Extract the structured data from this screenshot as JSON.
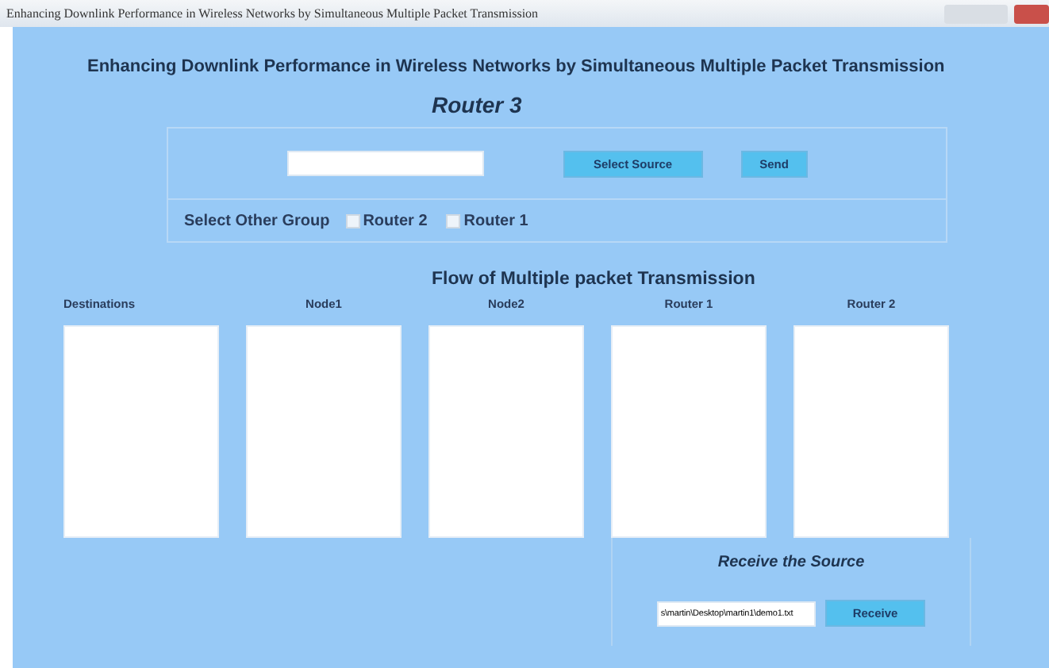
{
  "window": {
    "title": "Enhancing Downlink Performance in Wireless Networks by Simultaneous Multiple Packet Transmission"
  },
  "heading": "Enhancing Downlink Performance in Wireless Networks by Simultaneous Multiple Packet Transmission",
  "router_title": "Router 3",
  "source": {
    "buttons": [
      "Select Source",
      "Send"
    ]
  },
  "group": {
    "label": "Select Other Group",
    "options": [
      {
        "label": "Router 2",
        "checked": false
      },
      {
        "label": "Router 1",
        "checked": false
      }
    ]
  },
  "flow_title": "Flow of Multiple packet Transmission",
  "columns": [
    {
      "label": "Destinations"
    },
    {
      "label": "Node1"
    },
    {
      "label": "Node2"
    },
    {
      "label": "Router 1"
    },
    {
      "label": "Router 2"
    }
  ],
  "receive": {
    "title": "Receive the Source",
    "path": "s\\martin\\Desktop\\martin1\\demo1.txt",
    "button": "Receive"
  }
}
